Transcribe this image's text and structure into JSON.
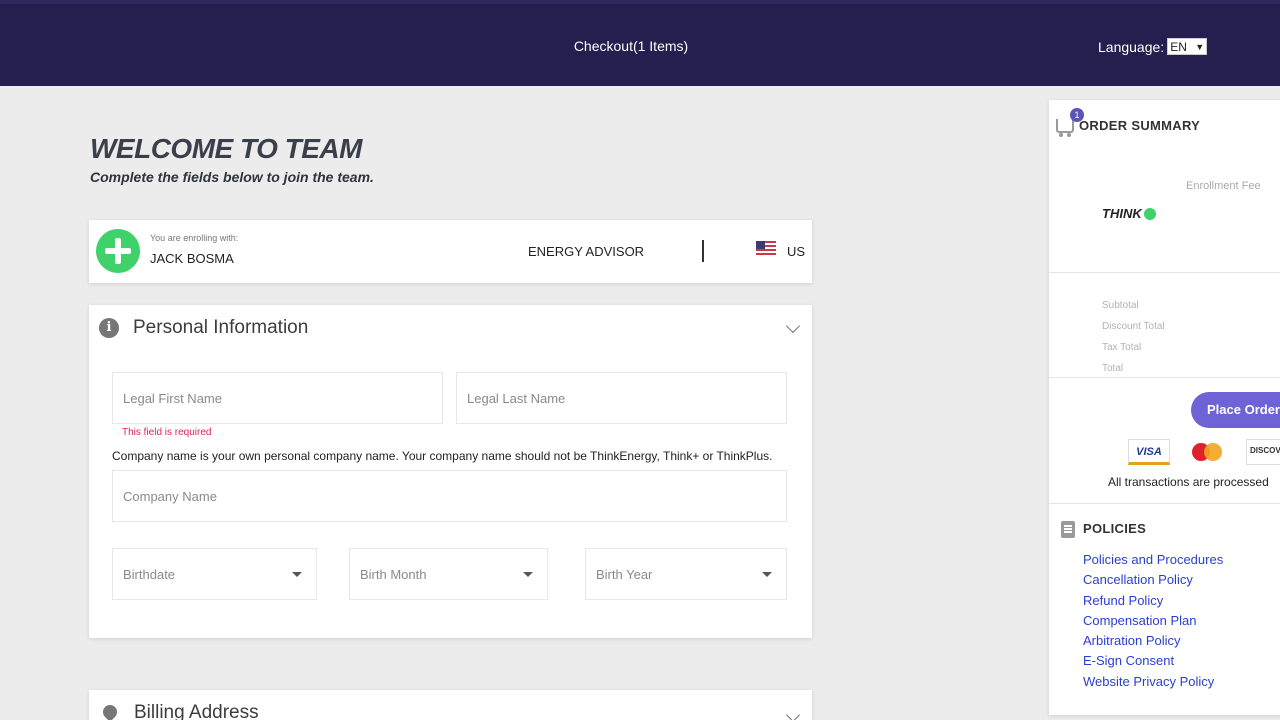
{
  "header": {
    "checkout_label": "Checkout(1 Items)",
    "language_label": "Language:",
    "language_value": "EN"
  },
  "welcome": {
    "title": "WELCOME TO TEAM",
    "subtitle": "Complete the fields below to join the team."
  },
  "enroll": {
    "small_label": "You are enrolling with:",
    "sponsor_name": "JACK BOSMA",
    "role": "ENERGY ADVISOR",
    "country": "US"
  },
  "personal": {
    "title": "Personal Information",
    "first_name_placeholder": "Legal First Name",
    "last_name_placeholder": "Legal Last Name",
    "error_text": "This field is required",
    "company_note": "Company name is your own personal company name. Your company name should not be ThinkEnergy, Think+ or ThinkPlus.",
    "company_placeholder": "Company Name",
    "birthdate_placeholder": "Birthdate",
    "birth_month_placeholder": "Birth Month",
    "birth_year_placeholder": "Birth Year"
  },
  "billing": {
    "title": "Billing Address"
  },
  "summary": {
    "cart_count": "1",
    "title": "ORDER SUMMARY",
    "fee_label": "Enrollment Fee",
    "logo_text": "THINK",
    "totals": [
      "Subtotal",
      "Discount Total",
      "Tax Total",
      "Total"
    ],
    "place_order_label": "Place Order",
    "visa_label": "VISA",
    "discover_label": "DISCOVER",
    "transactions_text": "All transactions are processed",
    "policies_title": "POLICIES",
    "policy_links": [
      "Policies and Procedures",
      "Cancellation Policy",
      "Refund Policy",
      "Compensation Plan",
      "Arbitration Policy",
      "E-Sign Consent",
      "Website Privacy Policy"
    ]
  }
}
